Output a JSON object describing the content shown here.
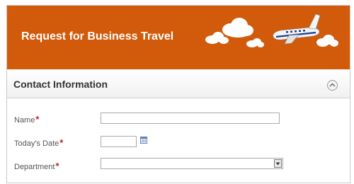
{
  "header": {
    "title": "Request for Business Travel"
  },
  "section": {
    "title": "Contact Information"
  },
  "form": {
    "name": {
      "label": "Name",
      "required_mark": "*",
      "value": ""
    },
    "todays_date": {
      "label": "Today's Date",
      "required_mark": "*",
      "value": ""
    },
    "department": {
      "label": "Department",
      "required_mark": "*",
      "selected": ""
    }
  },
  "colors": {
    "header_bg": "#d15b0b",
    "required": "#c81e1e"
  },
  "icons": {
    "collapse": "chevron-up-icon",
    "calendar": "calendar-icon",
    "dropdown": "chevron-down-icon",
    "illustration": "airplane-clouds-icon"
  }
}
